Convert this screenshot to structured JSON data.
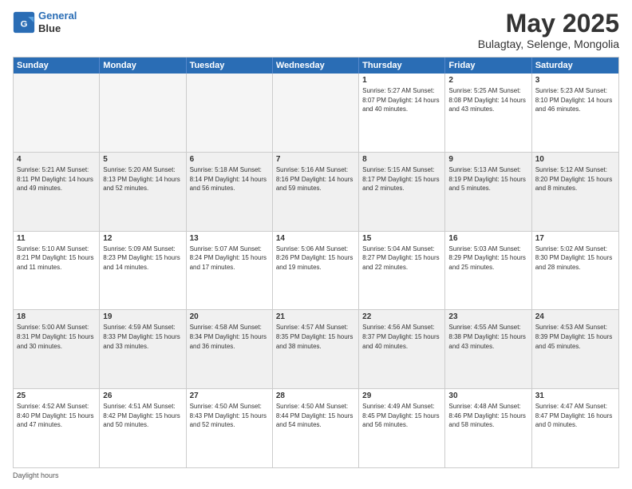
{
  "logo": {
    "line1": "General",
    "line2": "Blue"
  },
  "title": "May 2025",
  "subtitle": "Bulagtay, Selenge, Mongolia",
  "days_of_week": [
    "Sunday",
    "Monday",
    "Tuesday",
    "Wednesday",
    "Thursday",
    "Friday",
    "Saturday"
  ],
  "footer": "Daylight hours",
  "weeks": [
    [
      {
        "day": "",
        "info": "",
        "empty": true
      },
      {
        "day": "",
        "info": "",
        "empty": true
      },
      {
        "day": "",
        "info": "",
        "empty": true
      },
      {
        "day": "",
        "info": "",
        "empty": true
      },
      {
        "day": "1",
        "info": "Sunrise: 5:27 AM\nSunset: 8:07 PM\nDaylight: 14 hours\nand 40 minutes."
      },
      {
        "day": "2",
        "info": "Sunrise: 5:25 AM\nSunset: 8:08 PM\nDaylight: 14 hours\nand 43 minutes."
      },
      {
        "day": "3",
        "info": "Sunrise: 5:23 AM\nSunset: 8:10 PM\nDaylight: 14 hours\nand 46 minutes."
      }
    ],
    [
      {
        "day": "4",
        "info": "Sunrise: 5:21 AM\nSunset: 8:11 PM\nDaylight: 14 hours\nand 49 minutes."
      },
      {
        "day": "5",
        "info": "Sunrise: 5:20 AM\nSunset: 8:13 PM\nDaylight: 14 hours\nand 52 minutes."
      },
      {
        "day": "6",
        "info": "Sunrise: 5:18 AM\nSunset: 8:14 PM\nDaylight: 14 hours\nand 56 minutes."
      },
      {
        "day": "7",
        "info": "Sunrise: 5:16 AM\nSunset: 8:16 PM\nDaylight: 14 hours\nand 59 minutes."
      },
      {
        "day": "8",
        "info": "Sunrise: 5:15 AM\nSunset: 8:17 PM\nDaylight: 15 hours\nand 2 minutes."
      },
      {
        "day": "9",
        "info": "Sunrise: 5:13 AM\nSunset: 8:19 PM\nDaylight: 15 hours\nand 5 minutes."
      },
      {
        "day": "10",
        "info": "Sunrise: 5:12 AM\nSunset: 8:20 PM\nDaylight: 15 hours\nand 8 minutes."
      }
    ],
    [
      {
        "day": "11",
        "info": "Sunrise: 5:10 AM\nSunset: 8:21 PM\nDaylight: 15 hours\nand 11 minutes."
      },
      {
        "day": "12",
        "info": "Sunrise: 5:09 AM\nSunset: 8:23 PM\nDaylight: 15 hours\nand 14 minutes."
      },
      {
        "day": "13",
        "info": "Sunrise: 5:07 AM\nSunset: 8:24 PM\nDaylight: 15 hours\nand 17 minutes."
      },
      {
        "day": "14",
        "info": "Sunrise: 5:06 AM\nSunset: 8:26 PM\nDaylight: 15 hours\nand 19 minutes."
      },
      {
        "day": "15",
        "info": "Sunrise: 5:04 AM\nSunset: 8:27 PM\nDaylight: 15 hours\nand 22 minutes."
      },
      {
        "day": "16",
        "info": "Sunrise: 5:03 AM\nSunset: 8:29 PM\nDaylight: 15 hours\nand 25 minutes."
      },
      {
        "day": "17",
        "info": "Sunrise: 5:02 AM\nSunset: 8:30 PM\nDaylight: 15 hours\nand 28 minutes."
      }
    ],
    [
      {
        "day": "18",
        "info": "Sunrise: 5:00 AM\nSunset: 8:31 PM\nDaylight: 15 hours\nand 30 minutes."
      },
      {
        "day": "19",
        "info": "Sunrise: 4:59 AM\nSunset: 8:33 PM\nDaylight: 15 hours\nand 33 minutes."
      },
      {
        "day": "20",
        "info": "Sunrise: 4:58 AM\nSunset: 8:34 PM\nDaylight: 15 hours\nand 36 minutes."
      },
      {
        "day": "21",
        "info": "Sunrise: 4:57 AM\nSunset: 8:35 PM\nDaylight: 15 hours\nand 38 minutes."
      },
      {
        "day": "22",
        "info": "Sunrise: 4:56 AM\nSunset: 8:37 PM\nDaylight: 15 hours\nand 40 minutes."
      },
      {
        "day": "23",
        "info": "Sunrise: 4:55 AM\nSunset: 8:38 PM\nDaylight: 15 hours\nand 43 minutes."
      },
      {
        "day": "24",
        "info": "Sunrise: 4:53 AM\nSunset: 8:39 PM\nDaylight: 15 hours\nand 45 minutes."
      }
    ],
    [
      {
        "day": "25",
        "info": "Sunrise: 4:52 AM\nSunset: 8:40 PM\nDaylight: 15 hours\nand 47 minutes."
      },
      {
        "day": "26",
        "info": "Sunrise: 4:51 AM\nSunset: 8:42 PM\nDaylight: 15 hours\nand 50 minutes."
      },
      {
        "day": "27",
        "info": "Sunrise: 4:50 AM\nSunset: 8:43 PM\nDaylight: 15 hours\nand 52 minutes."
      },
      {
        "day": "28",
        "info": "Sunrise: 4:50 AM\nSunset: 8:44 PM\nDaylight: 15 hours\nand 54 minutes."
      },
      {
        "day": "29",
        "info": "Sunrise: 4:49 AM\nSunset: 8:45 PM\nDaylight: 15 hours\nand 56 minutes."
      },
      {
        "day": "30",
        "info": "Sunrise: 4:48 AM\nSunset: 8:46 PM\nDaylight: 15 hours\nand 58 minutes."
      },
      {
        "day": "31",
        "info": "Sunrise: 4:47 AM\nSunset: 8:47 PM\nDaylight: 16 hours\nand 0 minutes."
      }
    ]
  ]
}
